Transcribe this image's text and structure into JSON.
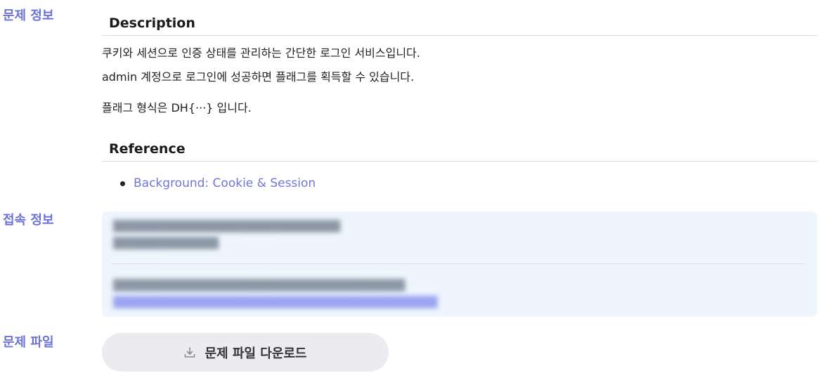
{
  "labels": {
    "problem_info": "문제 정보",
    "connection_info": "접속 정보",
    "problem_file": "문제 파일"
  },
  "description": {
    "heading": "Description",
    "line1": "쿠키와 세션으로 인증 상태를 관리하는 간단한 로그인 서비스입니다.",
    "line2": "admin 계정으로 로그인에 성공하면 플래그를 획득할 수 있습니다.",
    "line3": "플래그 형식은 DH{···} 입니다."
  },
  "reference": {
    "heading": "Reference",
    "items": [
      {
        "label": "Background: Cookie & Session"
      }
    ]
  },
  "download": {
    "label": "문제 파일 다운로드"
  },
  "colors": {
    "label_accent": "#6b74d6",
    "link": "#6f78d6",
    "connection_box_bg": "#eef5fd",
    "button_bg": "#ececf0"
  }
}
